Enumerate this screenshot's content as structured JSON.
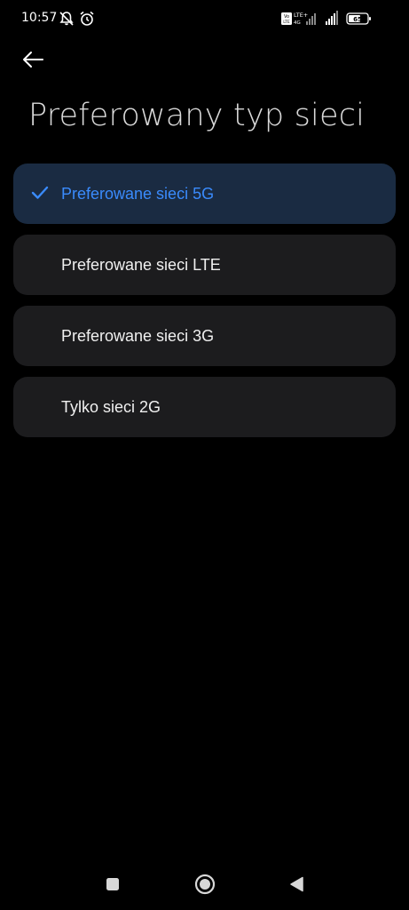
{
  "status_bar": {
    "time": "10:57",
    "icons": [
      "bell-off-icon",
      "alarm-icon"
    ],
    "right_icons": [
      "volte-icon",
      "lte-plus-signal-icon",
      "signal-icon",
      "battery-icon"
    ],
    "network_label": "LTE+",
    "network_sub": "4G",
    "volte_label": "Vo LTE",
    "battery_level": "65"
  },
  "header": {
    "back_icon": "back-arrow-icon",
    "title": "Preferowany typ sieci"
  },
  "options": [
    {
      "label": "Preferowane sieci 5G",
      "selected": true
    },
    {
      "label": "Preferowane sieci LTE",
      "selected": false
    },
    {
      "label": "Preferowane sieci 3G",
      "selected": false
    },
    {
      "label": "Tylko sieci 2G",
      "selected": false
    }
  ],
  "nav": {
    "recents_icon": "square-icon",
    "home_icon": "circle-icon",
    "back_icon": "triangle-back-icon"
  },
  "colors": {
    "background": "#000000",
    "card": "#1c1c1e",
    "selected_card": "#1a2b42",
    "accent": "#3a8bfd"
  }
}
